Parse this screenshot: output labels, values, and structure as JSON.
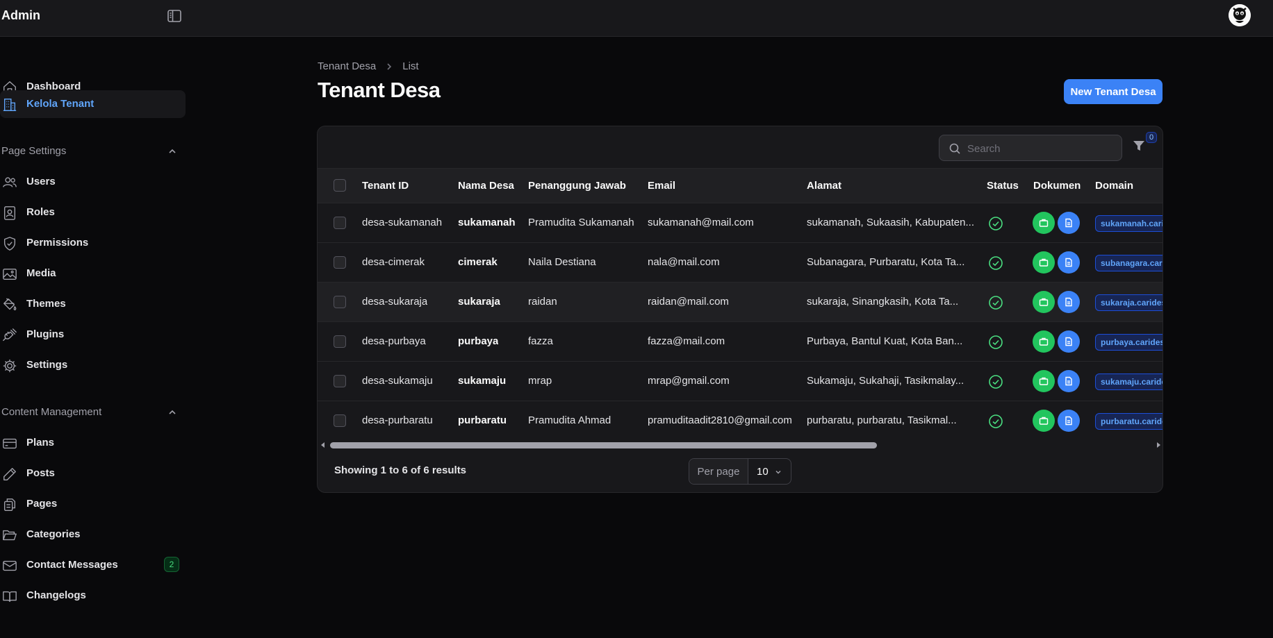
{
  "app": {
    "brand": "Admin"
  },
  "sidebar": {
    "top_items": [
      {
        "label": "Dashboard",
        "icon": "home-icon"
      },
      {
        "label": "Kelola Tenant",
        "icon": "building-icon",
        "active": true
      }
    ],
    "groups": [
      {
        "label": "Page Settings",
        "items": [
          {
            "label": "Users",
            "icon": "users-icon"
          },
          {
            "label": "Roles",
            "icon": "id-card-icon"
          },
          {
            "label": "Permissions",
            "icon": "shield-check-icon"
          },
          {
            "label": "Media",
            "icon": "image-icon"
          },
          {
            "label": "Themes",
            "icon": "paint-bucket-icon"
          },
          {
            "label": "Plugins",
            "icon": "plug-icon"
          },
          {
            "label": "Settings",
            "icon": "gear-icon"
          }
        ]
      },
      {
        "label": "Content Management",
        "items": [
          {
            "label": "Plans",
            "icon": "credit-card-icon"
          },
          {
            "label": "Posts",
            "icon": "pencil-icon"
          },
          {
            "label": "Pages",
            "icon": "document-duplicate-icon"
          },
          {
            "label": "Categories",
            "icon": "folder-open-icon"
          },
          {
            "label": "Contact Messages",
            "icon": "envelope-icon",
            "badge": "2"
          },
          {
            "label": "Changelogs",
            "icon": "book-open-icon"
          }
        ]
      }
    ]
  },
  "breadcrumb": [
    "Tenant Desa",
    "List"
  ],
  "page": {
    "title": "Tenant Desa",
    "new_button": "New Tenant Desa"
  },
  "table": {
    "search_placeholder": "Search",
    "filter_count": "0",
    "columns": [
      "Tenant ID",
      "Nama Desa",
      "Penanggung Jawab",
      "Email",
      "Alamat",
      "Status",
      "Dokumen",
      "Domain"
    ],
    "rows": [
      {
        "tenant_id": "desa-sukamanah",
        "nama_desa": "sukamanah",
        "pj": "Pramudita Sukamanah",
        "email": "sukamanah@mail.com",
        "alamat": "sukamanah, Sukaasih, Kabupaten...",
        "domain": "sukamanah.caridesa"
      },
      {
        "tenant_id": "desa-cimerak",
        "nama_desa": "cimerak",
        "pj": "Naila Destiana",
        "email": "nala@mail.com",
        "alamat": "Subanagara, Purbaratu, Kota Ta...",
        "domain": "subanagara.caridesa"
      },
      {
        "tenant_id": "desa-sukaraja",
        "nama_desa": "sukaraja",
        "pj": "raidan",
        "email": "raidan@mail.com",
        "alamat": "sukaraja, Sinangkasih, Kota Ta...",
        "domain": "sukaraja.caridesa"
      },
      {
        "tenant_id": "desa-purbaya",
        "nama_desa": "purbaya",
        "pj": "fazza",
        "email": "fazza@mail.com",
        "alamat": "Purbaya, Bantul Kuat, Kota Ban...",
        "domain": "purbaya.caridesa"
      },
      {
        "tenant_id": "desa-sukamaju",
        "nama_desa": "sukamaju",
        "pj": "mrap",
        "email": "mrap@gmail.com",
        "alamat": "Sukamaju, Sukahaji, Tasikmalay...",
        "domain": "sukamaju.caridesa"
      },
      {
        "tenant_id": "desa-purbaratu",
        "nama_desa": "purbaratu",
        "pj": "Pramudita Ahmad",
        "email": "pramuditaadit2810@gmail.com",
        "alamat": "purbaratu, purbaratu, Tasikmal...",
        "domain": "purbaratu.caridesa"
      }
    ],
    "showing": "Showing 1 to 6 of 6 results",
    "per_page_label": "Per page",
    "per_page_value": "10"
  },
  "colors": {
    "accent": "#3b82f6",
    "success": "#22c55e",
    "background": "#09090b",
    "surface": "#18181b"
  }
}
